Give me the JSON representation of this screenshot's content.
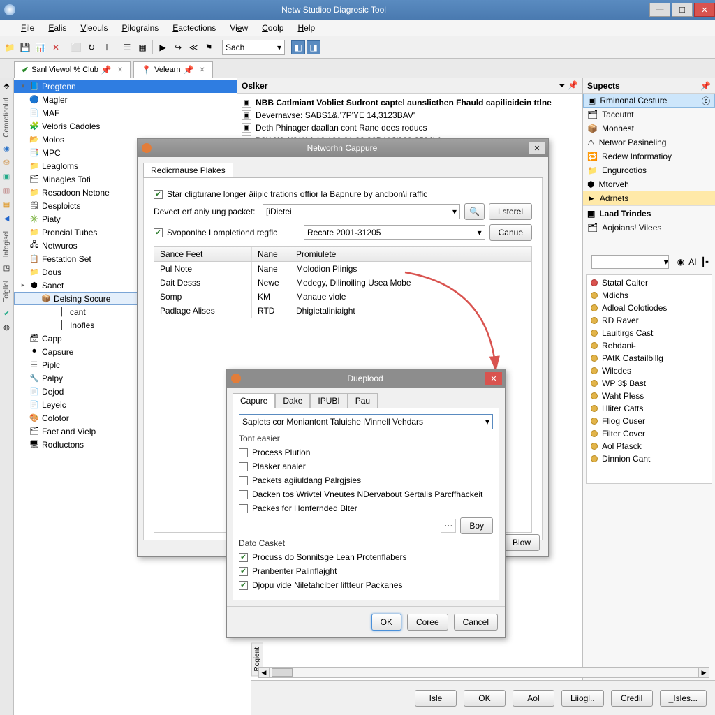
{
  "titlebar": {
    "title": "Netw Studioo Diagrosic Tool"
  },
  "menu": [
    "File",
    "Ealis",
    "Vieouls",
    "Pilograins",
    "Eactections",
    "View",
    "Coolp",
    "Help"
  ],
  "menu_underline_idx": [
    0,
    0,
    0,
    0,
    0,
    2,
    0,
    0
  ],
  "toolbar": {
    "search": "Sach"
  },
  "tabs": [
    {
      "label": "Sanl Viewol % Club",
      "pinned": true,
      "check": true
    },
    {
      "label": "Velearn",
      "pinned": true,
      "check": false
    }
  ],
  "tree_head": "",
  "tree": [
    {
      "l": 1,
      "exp": "▾",
      "ico": "📘",
      "t": "Progtenn",
      "sel": true
    },
    {
      "l": 1,
      "exp": "",
      "ico": "🔵",
      "t": "Magler"
    },
    {
      "l": 1,
      "exp": "",
      "ico": "📄",
      "t": "MAF"
    },
    {
      "l": 1,
      "exp": "",
      "ico": "🧩",
      "t": "Veloris Cadoles"
    },
    {
      "l": 1,
      "exp": "",
      "ico": "📂",
      "t": "Molos"
    },
    {
      "l": 1,
      "exp": "",
      "ico": "📑",
      "t": "MPC"
    },
    {
      "l": 1,
      "exp": "",
      "ico": "📁",
      "t": "Leagloms"
    },
    {
      "l": 1,
      "exp": "",
      "ico": "🗂",
      "t": "Minagles Toti"
    },
    {
      "l": 1,
      "exp": "",
      "ico": "📁",
      "t": "Resadoon Netone"
    },
    {
      "l": 1,
      "exp": "",
      "ico": "🗒",
      "t": "Desploicts"
    },
    {
      "l": 1,
      "exp": "",
      "ico": "✳️",
      "t": "Piaty"
    },
    {
      "l": 1,
      "exp": "",
      "ico": "📁",
      "t": "Proncial Tubes"
    },
    {
      "l": 1,
      "exp": "",
      "ico": "🖧",
      "t": "Netwuros"
    },
    {
      "l": 1,
      "exp": "",
      "ico": "📋",
      "t": "Festation Set"
    },
    {
      "l": 1,
      "exp": "",
      "ico": "📁",
      "t": "Dous"
    },
    {
      "l": 1,
      "exp": "▸",
      "ico": "⬢",
      "t": "Sanet"
    },
    {
      "l": 2,
      "exp": "",
      "ico": "📦",
      "t": "Delsing Socure",
      "box": true
    },
    {
      "l": 3,
      "exp": "",
      "ico": "│",
      "t": "cant"
    },
    {
      "l": 3,
      "exp": "",
      "ico": "│",
      "t": "Inofles"
    },
    {
      "l": 1,
      "exp": "",
      "ico": "🗃",
      "t": "Capp"
    },
    {
      "l": 1,
      "exp": "",
      "ico": "⏺",
      "t": "Capsure"
    },
    {
      "l": 1,
      "exp": "",
      "ico": "☰",
      "t": "Piplc"
    },
    {
      "l": 1,
      "exp": "",
      "ico": "🔧",
      "t": "Palpy"
    },
    {
      "l": 1,
      "exp": "",
      "ico": "📄",
      "t": "Dejod"
    },
    {
      "l": 1,
      "exp": "",
      "ico": "📄",
      "t": "Leyeic"
    },
    {
      "l": 1,
      "exp": "",
      "ico": "🎨",
      "t": "Colotor"
    },
    {
      "l": 1,
      "exp": "",
      "ico": "🗂",
      "t": "Faet and Vielp"
    },
    {
      "l": 1,
      "exp": "",
      "ico": "🖥",
      "t": "Rodluctons"
    }
  ],
  "center_head": "Oslker",
  "log": [
    {
      "ico": "▣",
      "t": "NBB Catlmiant Vobliet Sudront captel aunslicthen Fhauld capilicidein ttlne"
    },
    {
      "ico": "▣",
      "t": "Devernavse: SABS1&.'7P'YE 14,3123BAV'"
    },
    {
      "ico": "▣",
      "t": "Deth Phinager daallan cont Rane dees roducs"
    },
    {
      "ico": "▣",
      "t": "B3i16!2 1i21i14.16.100 01.88.36B Y $'900.850AV'"
    }
  ],
  "right": {
    "head": "Supects",
    "section1": "Rminonal Cesture",
    "items1": [
      {
        "ico": "🗂",
        "t": "Taceutnt"
      },
      {
        "ico": "📦",
        "t": "Monhest"
      },
      {
        "ico": "⚠",
        "t": "Networ Pasineling"
      },
      {
        "ico": "🔁",
        "t": "Redew Informatioy"
      },
      {
        "ico": "📁",
        "t": "Engurootios"
      },
      {
        "ico": "⬢",
        "t": "Mtorveh"
      },
      {
        "ico": "►",
        "t": "Adrnets",
        "sel": true
      }
    ],
    "section2": "Laad Trindes",
    "items2": [
      {
        "ico": "🗂",
        "t": "Aojoians! Vilees"
      }
    ],
    "toolbar_icons": [
      "●",
      "AI",
      "┃╸"
    ],
    "list": [
      "Statal Calter",
      "Mdichs",
      "Adloal Colotiodes",
      "RD Raver",
      "Lauitirgs Cast",
      "Rehdani-",
      "PAtK Castailbillg",
      "Wilcdes",
      "WP 3$ Bast",
      "Waht Pless",
      "Hliter Catts",
      "Fliog Ouser",
      "Filter Cover",
      "Aol Pfasck",
      "Dinnion Cant"
    ]
  },
  "dlg1": {
    "title": "Networhn Cappure",
    "tab": "Redicrnause Plakes",
    "chk1": "Star cligturane longer äiipic trations offior la Bapnure by andbon\\i raffic",
    "lbl1": "Devect erf aniy ung packet:",
    "in1": "[iDietei",
    "btn_search": "🔍",
    "btn_listel": "Lsterel",
    "chk2": "Svoponlhe Lompletiond regflc",
    "in2": "Recate 2001-31205",
    "btn_canve": "Canue",
    "grid_cols": [
      "Sance Feet",
      "",
      "Promiulete"
    ],
    "grid_cols2": [
      "",
      "Nane",
      ""
    ],
    "rows": [
      [
        "Pul Note",
        "Nane",
        "Molodion Plinigs"
      ],
      [
        "Dait Desss",
        "Newe",
        "Medegy, Dilinoiling Usea Mobe"
      ],
      [
        "Somp",
        "KM",
        "Manaue viole"
      ],
      [
        "Padlage Alises",
        "RTD",
        "Dhigietaliniaight"
      ]
    ],
    "btn_blow": "Blow"
  },
  "dlg2": {
    "title": "Dueplood",
    "tabs": [
      "Capure",
      "Dake",
      "IPUBI",
      "Pau"
    ],
    "combo": "Saplets cor Moniantont Taluishe iVinnell Vehdars",
    "group1": "Tont easier",
    "chk_a": [
      "Process Plution",
      "Plasker analer",
      "Packets agiiuldang Palrgjsies",
      "Dacken tos Wrivtel Vneutes NDervabout Sertalis Parcffhackeit",
      "Packes for Honfernded Blter"
    ],
    "btn_boy": "Boy",
    "group2": "Dato Casket",
    "chk_b": [
      "Procuss do Sonnitsge Lean Protenflabers",
      "Pranbenter Palinflajght",
      "Djopu vide Niletahciber liftteur Packanes"
    ],
    "btn_ok": "OK",
    "btn_core": "Coree",
    "btn_cancel": "Cancel"
  },
  "bottom": {
    "vt": "Rogient",
    "btns": [
      "Isle",
      "OK",
      "Aol",
      "Liiogl..",
      "Credil",
      "_Isles..."
    ]
  },
  "leftbar_vtext": [
    "Cemrotionluf",
    "Infogisel",
    "Tolgllol"
  ]
}
